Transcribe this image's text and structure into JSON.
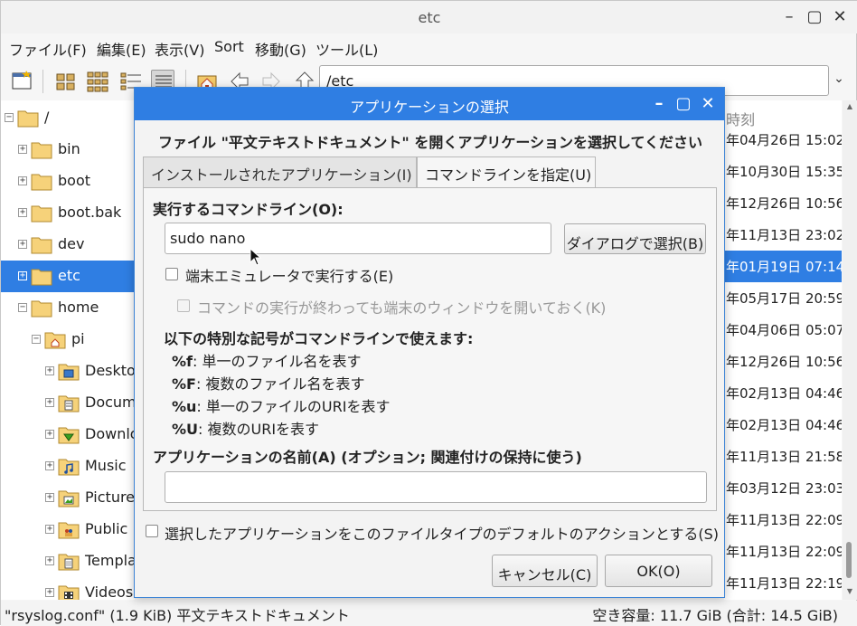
{
  "window": {
    "title": "etc"
  },
  "menu": [
    "ファイル(F)",
    "編集(E)",
    "表示(V)",
    "Sort",
    "移動(G)",
    "ツール(L)"
  ],
  "path": {
    "value": "/etc"
  },
  "tree": [
    {
      "label": "/",
      "expander": "−",
      "icon": "folder-icon"
    },
    {
      "label": "bin",
      "expander": "+",
      "icon": "folder-icon"
    },
    {
      "label": "boot",
      "expander": "+",
      "icon": "folder-icon"
    },
    {
      "label": "boot.bak",
      "expander": "+",
      "icon": "folder-icon"
    },
    {
      "label": "dev",
      "expander": "+",
      "icon": "folder-icon"
    },
    {
      "label": "etc",
      "expander": "+",
      "icon": "folder-icon",
      "selected": true
    },
    {
      "label": "home",
      "expander": "−",
      "icon": "folder-icon"
    },
    {
      "label": "pi",
      "expander": "−",
      "icon": "home-folder-icon"
    },
    {
      "label": "Desktop",
      "expander": "+",
      "icon": "desktop-folder-icon"
    },
    {
      "label": "Documents",
      "expander": "+",
      "icon": "documents-folder-icon"
    },
    {
      "label": "Downloads",
      "expander": "+",
      "icon": "downloads-folder-icon"
    },
    {
      "label": "Music",
      "expander": "+",
      "icon": "music-folder-icon"
    },
    {
      "label": "Pictures",
      "expander": "+",
      "icon": "pictures-folder-icon"
    },
    {
      "label": "Public",
      "expander": "+",
      "icon": "public-folder-icon"
    },
    {
      "label": "Templates",
      "expander": "+",
      "icon": "templates-folder-icon"
    },
    {
      "label": "Videos",
      "expander": "+",
      "icon": "videos-folder-icon"
    }
  ],
  "filelist": {
    "column_header": "時刻",
    "rows": [
      "年04月26日 15:02",
      "年10月30日 15:35",
      "年12月26日 10:56",
      "年11月13日 23:02",
      "年01月19日 07:14",
      "年05月17日 20:59",
      "年04月06日 05:07",
      "年12月26日 10:56",
      "年02月13日 04:46",
      "年02月13日 04:46",
      "年11月13日 21:58",
      "年03月12日 23:03",
      "年11月13日 22:09",
      "年11月13日 22:09",
      "年11月13日 22:19"
    ]
  },
  "status": {
    "left": "\"rsyslog.conf\" (1.9 KiB) 平文テキストドキュメント",
    "right": "空き容量: 11.7 GiB (合計: 14.5 GiB)"
  },
  "dialog": {
    "title": "アプリケーションの選択",
    "prompt": "ファイル \"平文テキストドキュメント\" を開くアプリケーションを選択してください",
    "tabs": [
      "インストールされたアプリケーション(I)",
      "コマンドラインを指定(U)"
    ],
    "cmd_label": "実行するコマンドライン(O):",
    "cmd_value": "sudo nano",
    "browse_button": "ダイアログで選択(B)",
    "terminal_check": "端末エミュレータで実行する(E)",
    "keep_open_check": "コマンドの実行が終わっても端末のウィンドウを開いておく(K)",
    "codes_heading": "以下の特別な記号がコマンドラインで使えます:",
    "codes": [
      {
        "code": "%f",
        "desc": ": 単一のファイル名を表す"
      },
      {
        "code": "%F",
        "desc": ": 複数のファイル名を表す"
      },
      {
        "code": "%u",
        "desc": ": 単一のファイルのURIを表す"
      },
      {
        "code": "%U",
        "desc": ": 複数のURIを表す"
      }
    ],
    "appname_label": "アプリケーションの名前(A) (オプション; 関連付けの保持に使う)",
    "appname_value": "",
    "default_check": "選択したアプリケーションをこのファイルタイプのデフォルトのアクションとする(S)",
    "cancel_button": "キャンセル(C)",
    "ok_button": "OK(O)"
  }
}
